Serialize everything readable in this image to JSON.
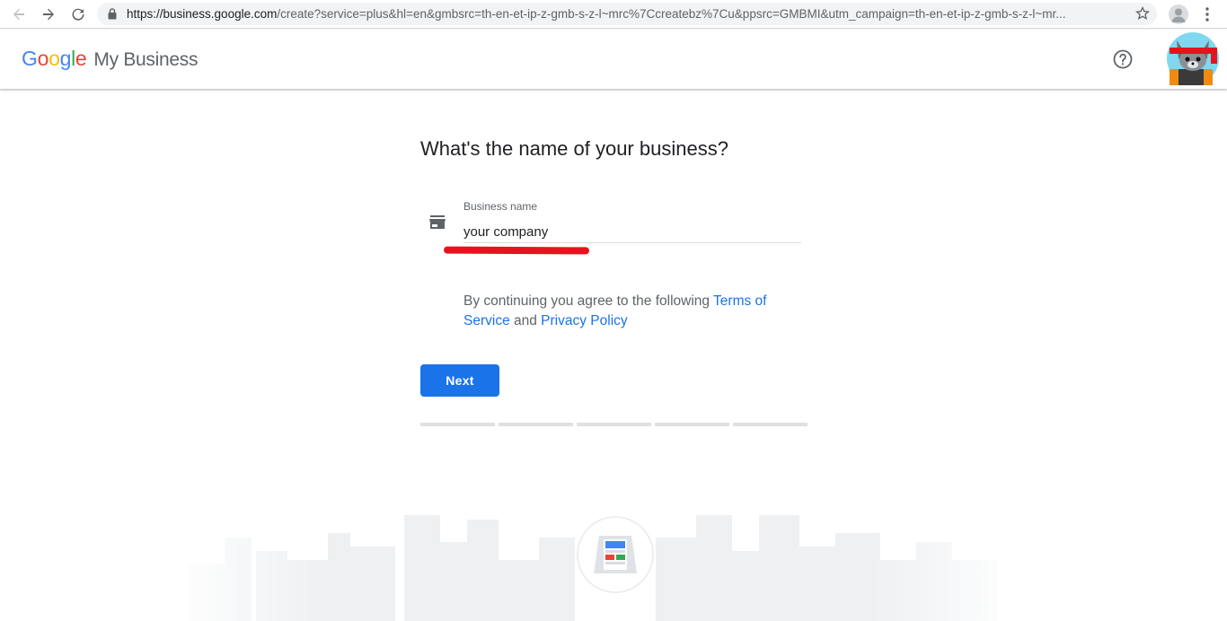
{
  "browser": {
    "url_host": "https://business.google.com",
    "url_path": "/create?service=plus&hl=en&gmbsrc=th-en-et-ip-z-gmb-s-z-l~mrc%7Ccreatebz%7Cu&ppsrc=GMBMI&utm_campaign=th-en-et-ip-z-gmb-s-z-l~mr...",
    "icons": [
      "back-arrow-icon",
      "forward-arrow-icon",
      "reload-icon",
      "lock-icon",
      "star-icon",
      "profile-icon",
      "kebab-menu-icon"
    ]
  },
  "header": {
    "logo_letters": [
      "G",
      "o",
      "o",
      "g",
      "l",
      "e"
    ],
    "product": "My Business",
    "help_icon": "help-circle-icon",
    "avatar_icon": "cat-avatar"
  },
  "form": {
    "title": "What's the name of your business?",
    "field_label": "Business name",
    "field_value": "your company",
    "field_icon": "storefront-icon",
    "terms_prefix": "By continuing you agree to the following ",
    "terms_link": "Terms of Service",
    "terms_middle": " and ",
    "privacy_link": "Privacy Policy",
    "next_label": "Next",
    "progress_steps": 5,
    "progress_current": 0
  },
  "colors": {
    "accent": "#1a73e8",
    "annotation": "#e8121f"
  }
}
